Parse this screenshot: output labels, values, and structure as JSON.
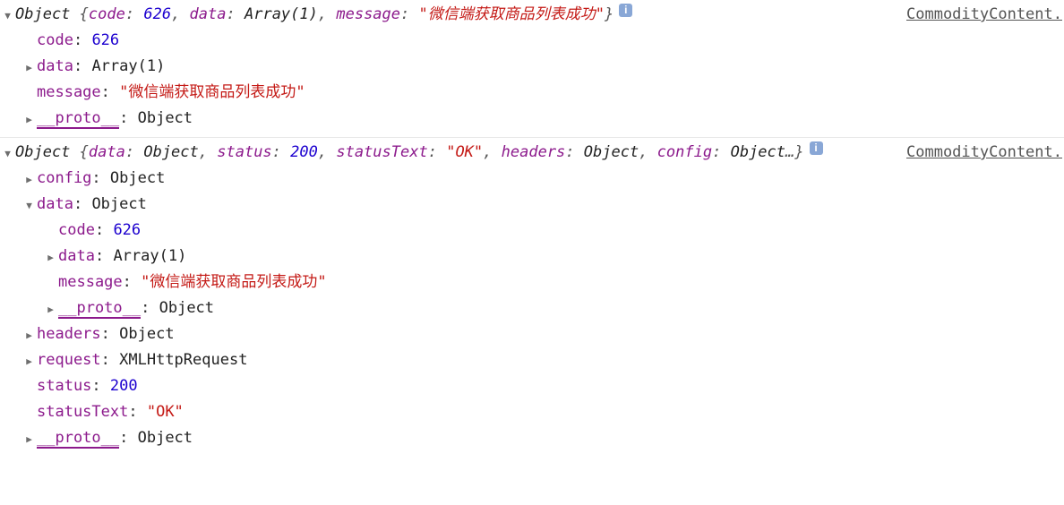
{
  "source_link": "CommodityContent.",
  "info_label": "i",
  "glyph": {
    "down": "▼",
    "right": "▶"
  },
  "entries": [
    {
      "preview_parts": [
        {
          "t": "cls",
          "v": "Object "
        },
        {
          "t": "plain",
          "v": "{"
        },
        {
          "t": "key",
          "v": "code"
        },
        {
          "t": "plain",
          "v": ": "
        },
        {
          "t": "num",
          "v": "626"
        },
        {
          "t": "plain",
          "v": ", "
        },
        {
          "t": "key",
          "v": "data"
        },
        {
          "t": "plain",
          "v": ": "
        },
        {
          "t": "cls",
          "v": "Array(1)"
        },
        {
          "t": "plain",
          "v": ", "
        },
        {
          "t": "key",
          "v": "message"
        },
        {
          "t": "plain",
          "v": ": "
        },
        {
          "t": "str",
          "v": "\"微信端获取商品列表成功\""
        },
        {
          "t": "plain",
          "v": "}"
        }
      ],
      "lines": [
        {
          "depth": 1,
          "toggle": "none",
          "key": "code",
          "vtype": "num",
          "value": "626"
        },
        {
          "depth": 1,
          "toggle": "closed",
          "key": "data",
          "vtype": "obj",
          "value": "Array(1)"
        },
        {
          "depth": 1,
          "toggle": "none",
          "key": "message",
          "vtype": "str",
          "value": "\"微信端获取商品列表成功\""
        },
        {
          "depth": 1,
          "toggle": "closed",
          "key": "__proto__",
          "vtype": "obj",
          "value": "Object",
          "proto": true
        }
      ]
    },
    {
      "preview_parts": [
        {
          "t": "cls",
          "v": "Object "
        },
        {
          "t": "plain",
          "v": "{"
        },
        {
          "t": "key",
          "v": "data"
        },
        {
          "t": "plain",
          "v": ": "
        },
        {
          "t": "cls",
          "v": "Object"
        },
        {
          "t": "plain",
          "v": ", "
        },
        {
          "t": "key",
          "v": "status"
        },
        {
          "t": "plain",
          "v": ": "
        },
        {
          "t": "num",
          "v": "200"
        },
        {
          "t": "plain",
          "v": ", "
        },
        {
          "t": "key",
          "v": "statusText"
        },
        {
          "t": "plain",
          "v": ": "
        },
        {
          "t": "str",
          "v": "\"OK\""
        },
        {
          "t": "plain",
          "v": ", "
        },
        {
          "t": "key",
          "v": "headers"
        },
        {
          "t": "plain",
          "v": ": "
        },
        {
          "t": "cls",
          "v": "Object"
        },
        {
          "t": "plain",
          "v": ", "
        },
        {
          "t": "key",
          "v": "config"
        },
        {
          "t": "plain",
          "v": ": "
        },
        {
          "t": "cls",
          "v": "Object"
        },
        {
          "t": "plain",
          "v": "…}"
        }
      ],
      "lines": [
        {
          "depth": 1,
          "toggle": "closed",
          "key": "config",
          "vtype": "obj",
          "value": "Object"
        },
        {
          "depth": 1,
          "toggle": "open",
          "key": "data",
          "vtype": "obj",
          "value": "Object"
        },
        {
          "depth": 2,
          "toggle": "none",
          "key": "code",
          "vtype": "num",
          "value": "626"
        },
        {
          "depth": 2,
          "toggle": "closed",
          "key": "data",
          "vtype": "obj",
          "value": "Array(1)"
        },
        {
          "depth": 2,
          "toggle": "none",
          "key": "message",
          "vtype": "str",
          "value": "\"微信端获取商品列表成功\""
        },
        {
          "depth": 2,
          "toggle": "closed",
          "key": "__proto__",
          "vtype": "obj",
          "value": "Object",
          "proto": true
        },
        {
          "depth": 1,
          "toggle": "closed",
          "key": "headers",
          "vtype": "obj",
          "value": "Object"
        },
        {
          "depth": 1,
          "toggle": "closed",
          "key": "request",
          "vtype": "obj",
          "value": "XMLHttpRequest"
        },
        {
          "depth": 1,
          "toggle": "none",
          "key": "status",
          "vtype": "num",
          "value": "200"
        },
        {
          "depth": 1,
          "toggle": "none",
          "key": "statusText",
          "vtype": "str",
          "value": "\"OK\""
        },
        {
          "depth": 1,
          "toggle": "closed",
          "key": "__proto__",
          "vtype": "obj",
          "value": "Object",
          "proto": true
        }
      ]
    }
  ]
}
